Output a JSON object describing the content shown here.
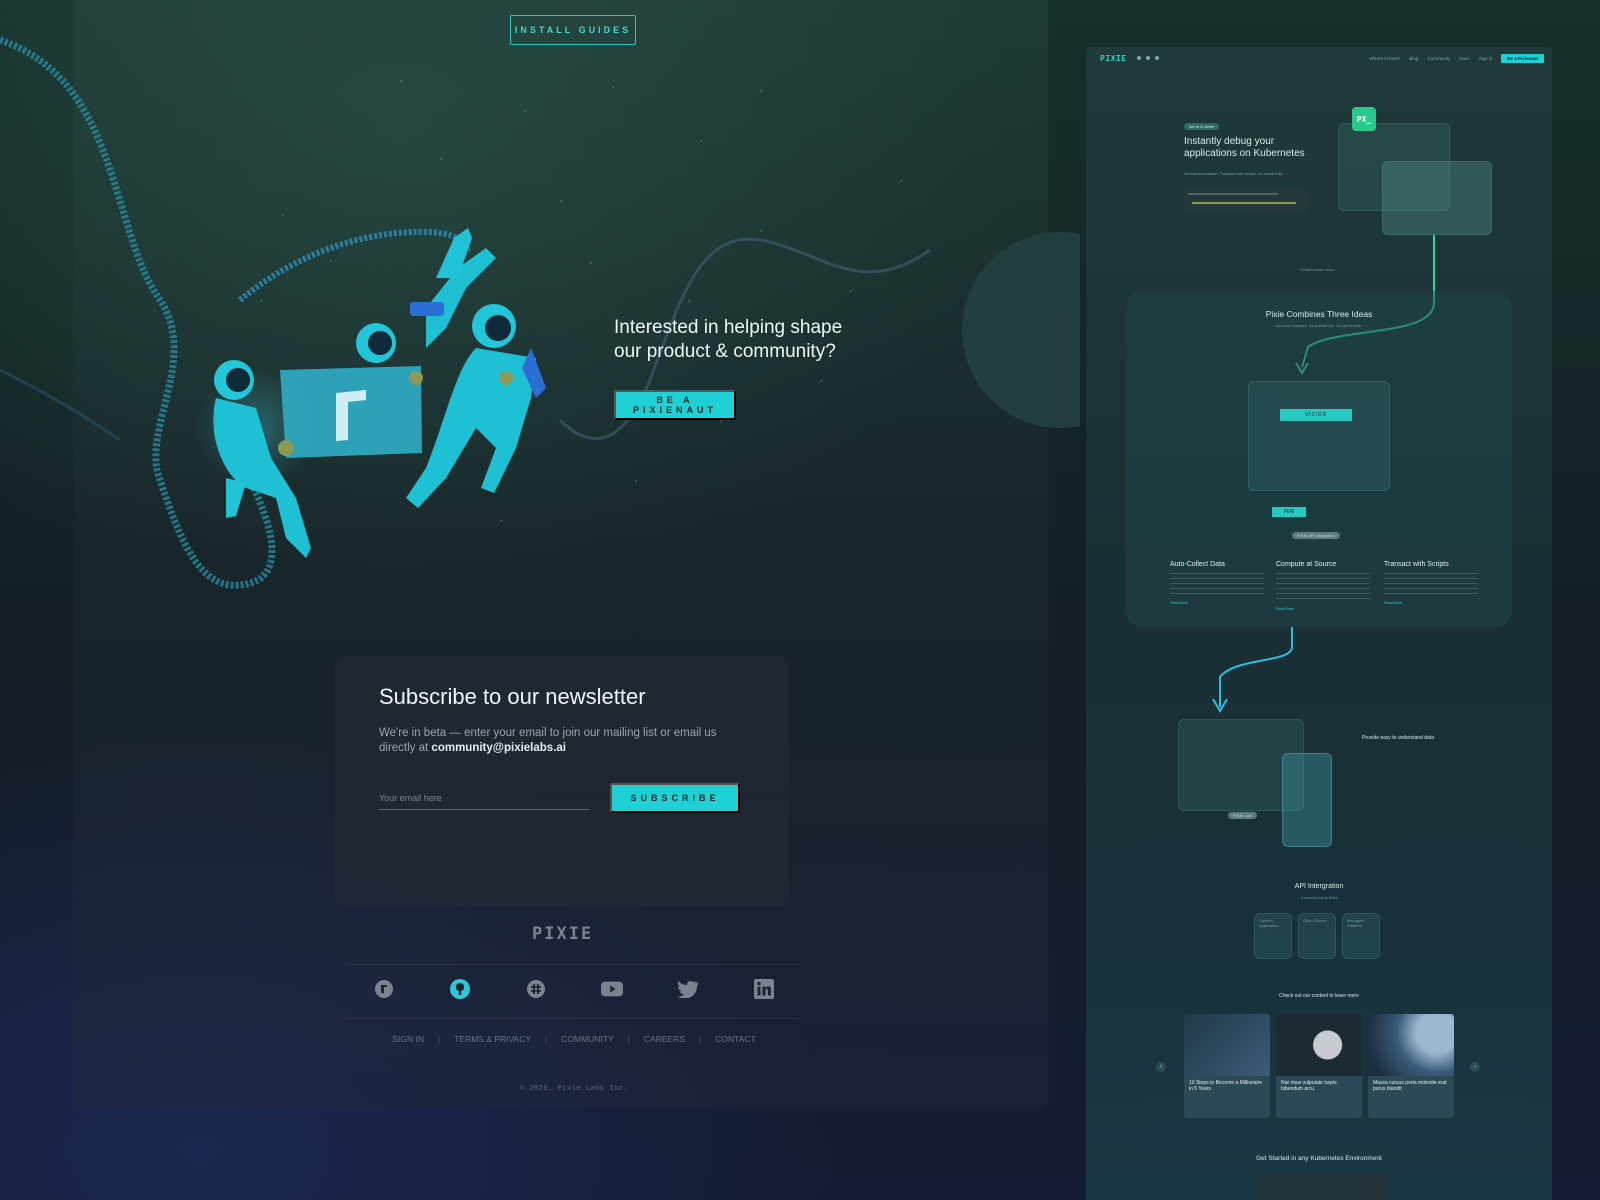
{
  "left": {
    "install_guides_label": "INSTALL GUIDES",
    "hero_heading_line1": "Interested in helping shape",
    "hero_heading_line2": "our product & community?",
    "hero_button_label": "BE A PIXIENAUT",
    "newsletter": {
      "title": "Subscribe to our newsletter",
      "body_prefix": "We're in beta — enter your email to join our mailing list or email us directly at ",
      "email": "community@pixielabs.ai",
      "input_placeholder": "Your email here",
      "button_label": "SUBSCRIBE"
    },
    "footer": {
      "logo_text": "PIXIE",
      "social_icons": [
        "pixie-icon",
        "github-icon",
        "slack-icon",
        "youtube-icon",
        "twitter-icon",
        "linkedin-icon"
      ],
      "links": [
        "SIGN IN",
        "TERMS & PRIVACY",
        "COMMUNITY",
        "CAREERS",
        "CONTACT"
      ],
      "copyright": "© 2020, Pixie Labs Inc."
    }
  },
  "preview": {
    "nav": {
      "logo": "PIXIE",
      "links": [
        "What's in beta?",
        "Blog",
        "Community",
        "Docs",
        "Sign in"
      ],
      "cta": "Be a Pixienaut"
    },
    "hero": {
      "badge": "We're in Beta!",
      "title_line1": "Instantly debug your",
      "title_line2": "applications on Kubernetes",
      "subtitle": "No instrumentation. Transact with scripts. All inside K8s.",
      "scroll_hint": "Scroll to learn more"
    },
    "ideas": {
      "title": "Pixie Combines Three Ideas",
      "subtitle": "No code changes. No painful UIs. No grunt work.",
      "vizier_label": "VIZIER",
      "pem_label": "PEM",
      "integration_pill": "PIXIE API Integration",
      "columns": [
        {
          "title": "Auto-Collect Data",
          "link": "Read More"
        },
        {
          "title": "Compute at Source",
          "link": "Read More"
        },
        {
          "title": "Transact with Scripts",
          "link": "Read More"
        }
      ]
    },
    "data_section": {
      "title": "Provide easy to understand data",
      "live_pill": "PIXIE Live"
    },
    "api": {
      "title": "API Intergration",
      "subtitle": "Currently not in Beta",
      "cards": [
        "Custom Application",
        "Open Source",
        "Managed Platform"
      ]
    },
    "content": {
      "heading": "Check out our content to learn more",
      "cards": [
        {
          "title": "10 Steps to Become a Millionaire in 5 Years",
          "color": "#243a44"
        },
        {
          "title": "Nisi risus vulputate turpis bibendum arcu",
          "color": "#2a3f48"
        },
        {
          "title": "Massa cursus porta molestie erat purus blandit",
          "color": "#2d4c5c"
        }
      ]
    },
    "get_started": "Get Started in any Kubernetes Environment"
  },
  "colors": {
    "accent": "#1fd0d4",
    "background": "#141d24",
    "text_muted": "#9aa7b0"
  }
}
